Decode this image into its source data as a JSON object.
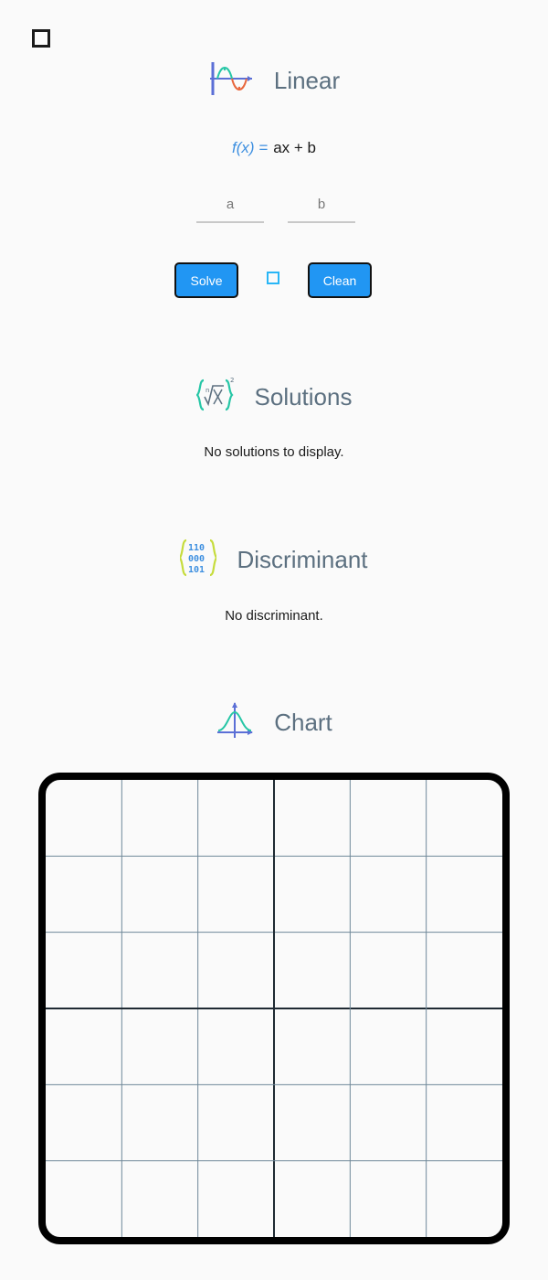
{
  "nav": {
    "menu_icon": "square-outline-icon"
  },
  "linear": {
    "title": "Linear",
    "icon": "function-wave-icon",
    "formula_fx": "f(x) =",
    "formula_expr": "ax + b",
    "input_a_placeholder": "a",
    "input_b_placeholder": "b",
    "solve_label": "Solve",
    "clean_label": "Clean",
    "separator_icon": "square-small-icon"
  },
  "solutions": {
    "title": "Solutions",
    "icon": "root-braces-icon",
    "message": "No solutions to display."
  },
  "discriminant": {
    "title": "Discriminant",
    "icon": "binary-braces-icon",
    "message": "No discriminant."
  },
  "chart": {
    "title": "Chart",
    "icon": "bell-curve-icon"
  },
  "chart_data": {
    "type": "line",
    "title": "",
    "xlabel": "",
    "ylabel": "",
    "grid": true,
    "series": [],
    "colors": {
      "grid": "#6f8899",
      "axis": "#1f2a33"
    }
  }
}
